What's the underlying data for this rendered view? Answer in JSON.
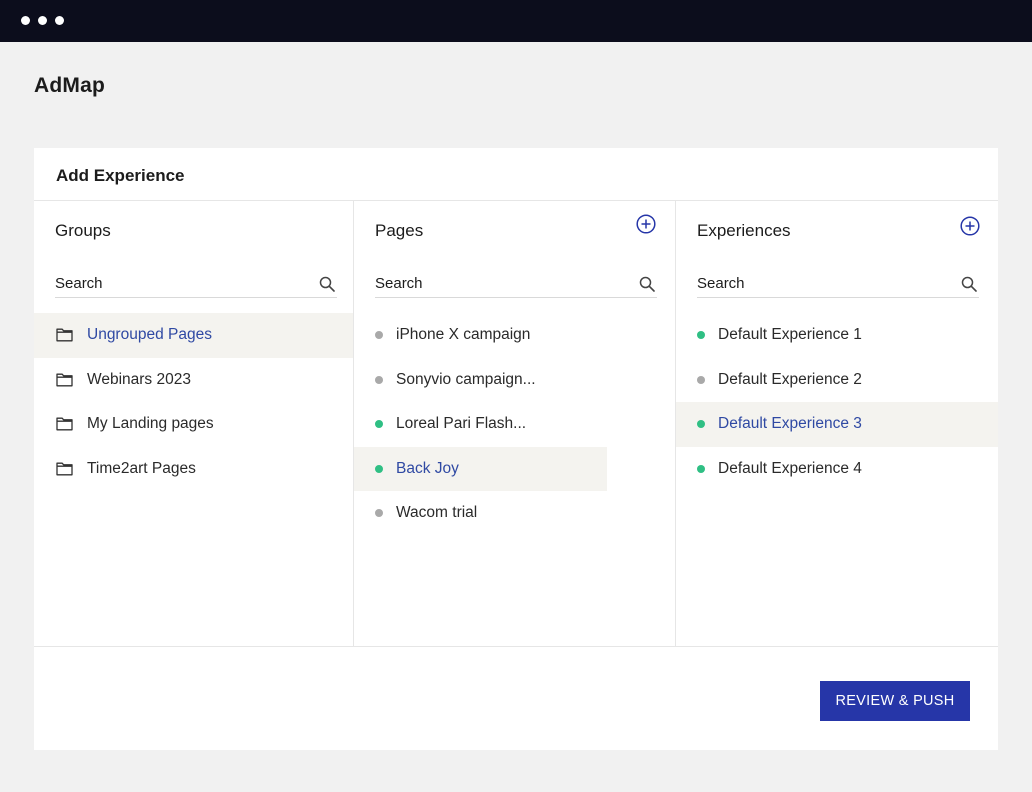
{
  "window": {
    "dots": 3
  },
  "app": {
    "title": "AdMap"
  },
  "card": {
    "title": "Add Experience"
  },
  "colors": {
    "accent": "#2636a8",
    "selected_text": "#2f49a3",
    "status_active": "#2fbf84",
    "status_inactive": "#a9a9a9"
  },
  "groups": {
    "title": "Groups",
    "search_placeholder": "Search",
    "items": [
      {
        "label": "Ungrouped Pages",
        "selected": true
      },
      {
        "label": "Webinars 2023",
        "selected": false
      },
      {
        "label": "My Landing pages",
        "selected": false
      },
      {
        "label": "Time2art Pages",
        "selected": false
      }
    ]
  },
  "pages": {
    "title": "Pages",
    "search_placeholder": "Search",
    "add_icon": "plus-circle-icon",
    "items": [
      {
        "label": "iPhone X campaign",
        "status": "inactive",
        "selected": false
      },
      {
        "label": "Sonyvio campaign...",
        "status": "inactive",
        "selected": false
      },
      {
        "label": "Loreal Pari Flash...",
        "status": "active",
        "selected": false
      },
      {
        "label": "Back Joy",
        "status": "active",
        "selected": true
      },
      {
        "label": "Wacom trial",
        "status": "inactive",
        "selected": false
      }
    ]
  },
  "experiences": {
    "title": "Experiences",
    "search_placeholder": "Search",
    "add_icon": "plus-circle-icon",
    "items": [
      {
        "label": "Default Experience 1",
        "status": "active",
        "selected": false
      },
      {
        "label": "Default Experience 2",
        "status": "inactive",
        "selected": false
      },
      {
        "label": "Default Experience 3",
        "status": "active",
        "selected": true
      },
      {
        "label": "Default Experience 4",
        "status": "active",
        "selected": false
      }
    ]
  },
  "footer": {
    "review_label": "REVIEW & PUSH"
  }
}
